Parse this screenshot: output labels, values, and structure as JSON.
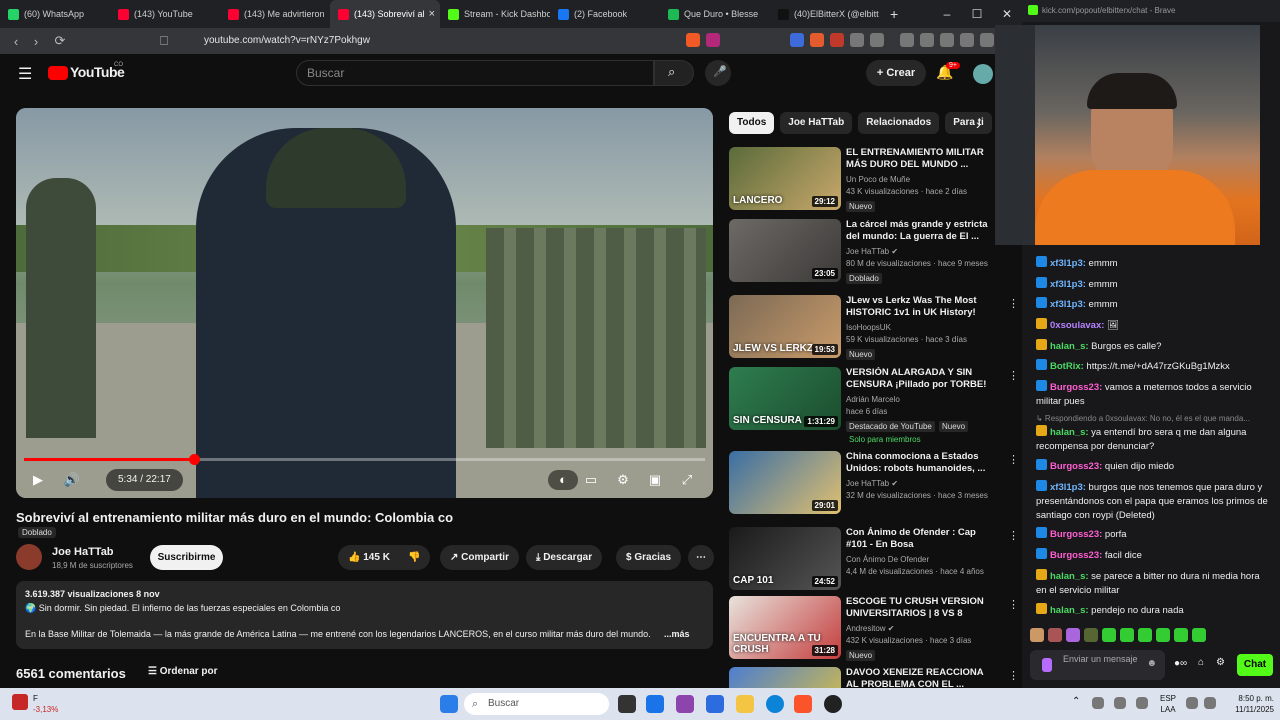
{
  "browser": {
    "tabs": [
      {
        "label": "(60) WhatsApp",
        "color": "#25d366"
      },
      {
        "label": "(143) YouTube",
        "color": "#ff0033"
      },
      {
        "label": "(143) Me advirtieron",
        "color": "#ff0033"
      },
      {
        "label": "(143) Sobreviví al",
        "color": "#ff0033"
      },
      {
        "label": "Stream - Kick Dashbo",
        "color": "#53fc18"
      },
      {
        "label": "(2) Facebook",
        "color": "#1877f2"
      },
      {
        "label": "Que Duro • Blesse",
        "color": "#1db954"
      },
      {
        "label": "(40)ElBitterX (@elbitt",
        "color": "#111111"
      }
    ],
    "new_tab": "+",
    "url": "youtube.com/watch?v=rNYz7Pokhgw"
  },
  "youtube": {
    "logo_text": "YouTube",
    "logo_sup": "CO",
    "search_placeholder": "Buscar",
    "create_label": "Crear",
    "notif_count": "9+",
    "player": {
      "time": "5:34 / 22:17",
      "progress_fraction": 0.25
    },
    "video_title": "Sobreviví al entrenamiento militar más duro en el mundo: Colombia co",
    "dubbed_label": "Doblado",
    "channel_name": "Joe HaTTab",
    "subscribers": "18,9 M de suscriptores",
    "subscribe_label": "Suscribirme",
    "likes": "145 K",
    "share_label": "Compartir",
    "download_label": "Descargar",
    "thanks_label": "Gracias",
    "views_date": "3.619.387 visualizaciones  8 nov",
    "desc_line1": "🌍 Sin dormir. Sin piedad. El infierno de las fuerzas especiales en Colombia co",
    "desc_line2": "En la Base Militar de Tolemaida — la más grande de América Latina — me entrené con los legendarios LANCEROS, en el curso militar más duro del mundo.",
    "desc_more": "...más",
    "comments_count": "6561 comentarios",
    "sort_label": "Ordenar por",
    "chips": [
      "Todos",
      "Joe HaTTab",
      "Relacionados",
      "Para ti"
    ],
    "recommendations": [
      {
        "title": "EL ENTRENAMIENTO MILITAR MÁS DURO DEL MUNDO ...",
        "channel": "Un Poco de Muñe",
        "meta": "43 K visualizaciones · hace 2 días",
        "badge": "Nuevo",
        "duration": "29:12",
        "thumb_text": "LANCERO",
        "c1": "#5a6b3a",
        "c2": "#c9a86b"
      },
      {
        "title": "La cárcel más grande y estricta del mundo: La guerra de El ...",
        "channel": "Joe HaTTab ✔",
        "meta": "80 M de visualizaciones · hace 9 meses",
        "badge": "Doblado",
        "duration": "23:05",
        "thumb_text": "",
        "c1": "#6d6a66",
        "c2": "#3c3a38"
      },
      {
        "title": "JLew vs Lerkz Was The Most HISTORIC 1v1 in UK History!",
        "channel": "IsoHoopsUK",
        "meta": "59 K visualizaciones · hace 3 días",
        "badge": "Nuevo",
        "duration": "19:53",
        "thumb_text": "JLEW VS LERKZ",
        "c1": "#7c6a55",
        "c2": "#c99b6a"
      },
      {
        "title": "VERSIÓN ALARGADA Y SIN CENSURA ¡Pillado por TORBE! ...",
        "channel": "Adrián Marcelo",
        "meta": "hace 6 días",
        "badge": "Destacado de YouTube",
        "duration": "1:31:29",
        "thumb_text": "SIN CENSURA",
        "c1": "#2e7d4f",
        "c2": "#1b4d2e"
      },
      {
        "title": "China conmociona a Estados Unidos: robots humanoides, ...",
        "channel": "Joe HaTTab ✔",
        "meta": "32 M de visualizaciones · hace 3 meses",
        "badge": "",
        "duration": "29:01",
        "thumb_text": "",
        "c1": "#3a6ea5",
        "c2": "#e0c070"
      },
      {
        "title": "Con Ánimo de Ofender : Cap #101 - En Bosa",
        "channel": "Con Ánimo De Ofender",
        "meta": "4,4 M de visualizaciones · hace 4 años",
        "badge": "",
        "duration": "24:52",
        "thumb_text": "CAP 101",
        "c1": "#1a1a1a",
        "c2": "#555555"
      },
      {
        "title": "ESCOGE TU CRUSH VERSION UNIVERSITARIOS | 8 VS 8",
        "channel": "Andresitow ✔",
        "meta": "432 K visualizaciones · hace 3 días",
        "badge": "Nuevo",
        "duration": "31:28",
        "thumb_text": "ENCUENTRA A TU CRUSH",
        "c1": "#e8e3dc",
        "c2": "#c43d3d"
      },
      {
        "title": "DAVOO XENEIZE REACCIONA AL PROBLEMA CON EL ...",
        "channel": "",
        "meta": "",
        "badge": "",
        "duration": "",
        "thumb_text": "",
        "c1": "#4c7ed0",
        "c2": "#e4c43a"
      }
    ],
    "members_badge": "Solo para miembros",
    "new_badge": "Nuevo"
  },
  "kick": {
    "window_url": "kick.com/popout/elbitterx/chat - Brave",
    "messages": [
      {
        "user": "xf3l1p3:",
        "text": " emmm",
        "color": "#6fb5ff",
        "icon": "#1e88e5"
      },
      {
        "user": "xf3l1p3:",
        "text": " emmm",
        "color": "#6fb5ff",
        "icon": "#1e88e5"
      },
      {
        "user": "xf3l1p3:",
        "text": " emmm",
        "color": "#6fb5ff",
        "icon": "#1e88e5"
      },
      {
        "user": "0xsoulavax:",
        "text": " 🖼",
        "color": "#b583ff",
        "icon": "#e6a817"
      },
      {
        "user": "halan_s:",
        "text": " Burgos es calle?",
        "color": "#4cd964",
        "icon": "#e6a817"
      },
      {
        "user": "BotRix:",
        "text": " https://t.me/+dA47rzGKuBg1Mzkx",
        "color": "#4cd964",
        "icon": "#1e88e5"
      },
      {
        "user": "Burgoss23:",
        "text": " vamos a meternos todos a servicio militar pues",
        "color": "#ff5fd2",
        "icon": "#1e88e5"
      },
      {
        "user": "",
        "text": "↳ Respondiendo a 0xsoulavax: No no, él es el que manda...",
        "color": "#888",
        "icon": ""
      },
      {
        "user": "halan_s:",
        "text": " ya entendí bro sera q me dan alguna recompensa por denunciar?",
        "color": "#4cd964",
        "icon": "#e6a817"
      },
      {
        "user": "Burgoss23:",
        "text": " quien dijo miedo",
        "color": "#ff5fd2",
        "icon": "#1e88e5"
      },
      {
        "user": "xf3l1p3:",
        "text": " burgos que nos tenemos que para duro y presentándonos con el papa que eramos los primos de santiago con roypi (Deleted)",
        "color": "#6fb5ff",
        "icon": "#1e88e5"
      },
      {
        "user": "Burgoss23:",
        "text": " porfa",
        "color": "#ff5fd2",
        "icon": "#1e88e5"
      },
      {
        "user": "Burgoss23:",
        "text": " facil dice",
        "color": "#ff5fd2",
        "icon": "#1e88e5"
      },
      {
        "user": "halan_s:",
        "text": " se parece a bitter no dura ni media hora en el servicio militar",
        "color": "#4cd964",
        "icon": "#e6a817"
      },
      {
        "user": "halan_s:",
        "text": " pendejo no dura nada",
        "color": "#4cd964",
        "icon": "#e6a817"
      }
    ],
    "input_placeholder": "Enviar un mensaje",
    "chat_button": "Chat"
  },
  "taskbar": {
    "weather_temp": "F",
    "weather_change": "-3,13%",
    "search_placeholder": "Buscar",
    "lang": "ESP",
    "lang2": "LAA",
    "time": "8:50 p. m.",
    "date": "11/11/2025"
  }
}
